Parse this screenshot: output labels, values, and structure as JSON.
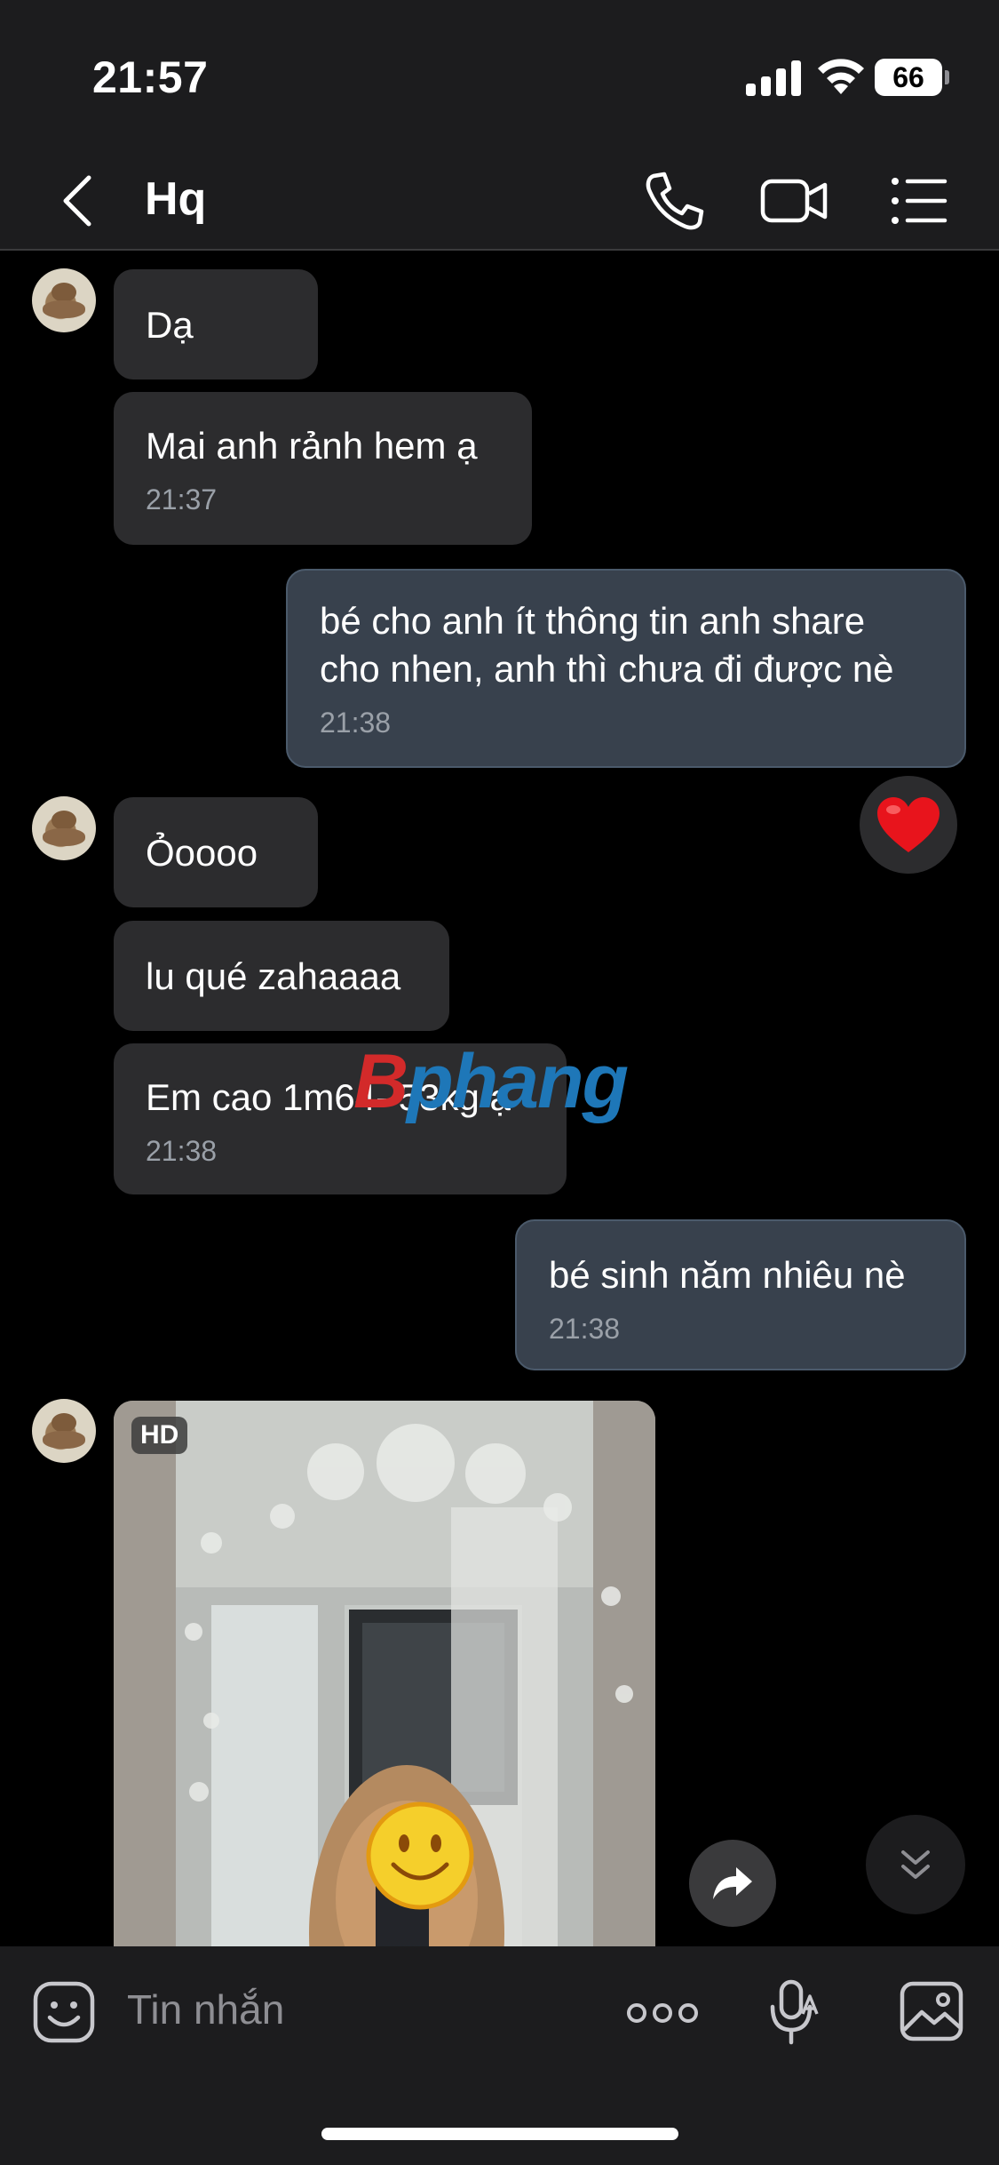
{
  "status_bar": {
    "time": "21:57",
    "battery": "66"
  },
  "header": {
    "title": "Hq",
    "icons": [
      "back-chevron-icon",
      "phone-icon",
      "video-camera-icon",
      "list-menu-icon"
    ]
  },
  "messages": [
    {
      "side": "in",
      "text": "Dạ"
    },
    {
      "side": "in",
      "text": "Mai anh rảnh hem ạ",
      "time": "21:37"
    },
    {
      "side": "out",
      "text": "bé cho anh ít thông tin anh share\ncho nhen, anh thì chưa đi được nè",
      "time": "21:38",
      "reaction": "heart"
    },
    {
      "side": "in",
      "text": "Ỏoooo"
    },
    {
      "side": "in",
      "text": "lu qué zahaaaa"
    },
    {
      "side": "in",
      "text": "Em cao 1m64- 53kg ạ",
      "time": "21:38"
    },
    {
      "side": "out",
      "text": "bé sinh năm nhiêu nè",
      "time": "21:38"
    },
    {
      "side": "in",
      "type": "image",
      "badge": "HD"
    }
  ],
  "watermark": {
    "prefix": "B",
    "rest": "phang"
  },
  "input": {
    "placeholder": "Tin nhắn"
  },
  "colors": {
    "background": "#000000",
    "incoming_bubble": "#2c2c2e",
    "outgoing_bubble": "#38414d",
    "reaction": "#e8141c"
  }
}
